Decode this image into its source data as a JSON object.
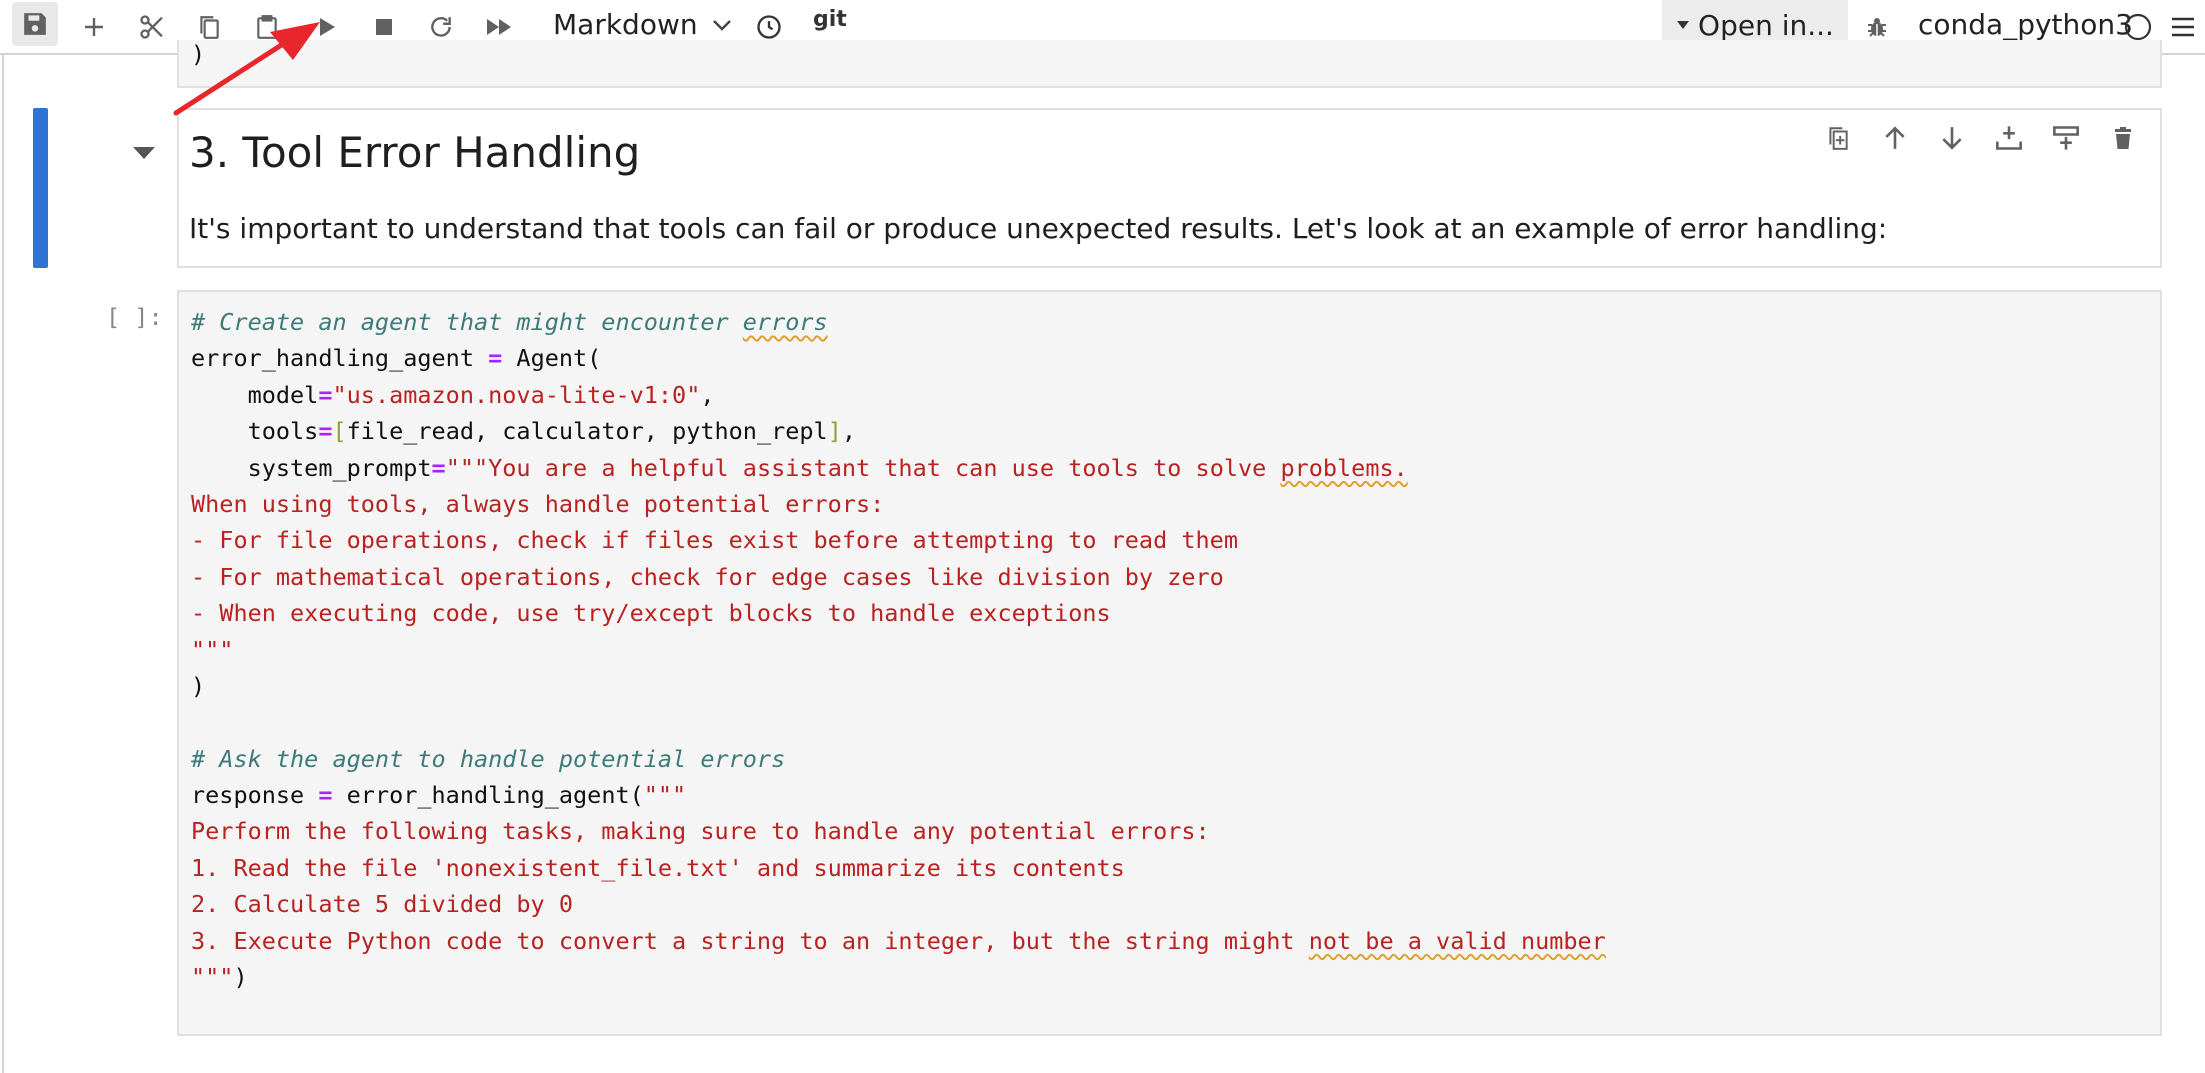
{
  "toolbar": {
    "buttons": [
      {
        "name": "save",
        "icon": "floppy-disk-icon"
      },
      {
        "name": "insert-cell",
        "icon": "plus-icon"
      },
      {
        "name": "cut",
        "icon": "scissors-icon"
      },
      {
        "name": "copy",
        "icon": "copy-icon"
      },
      {
        "name": "paste",
        "icon": "clipboard-icon"
      },
      {
        "name": "run",
        "icon": "play-icon"
      },
      {
        "name": "interrupt",
        "icon": "stop-icon"
      },
      {
        "name": "restart",
        "icon": "refresh-icon"
      },
      {
        "name": "run-all",
        "icon": "fast-forward-icon"
      },
      {
        "name": "history",
        "icon": "clock-icon"
      }
    ],
    "cell_type": "Markdown",
    "git_label": "git",
    "open_in_label": "Open in...",
    "kernel_name": "conda_python3",
    "kernel_status": "idle"
  },
  "previous_cell": {
    "last_line": ")"
  },
  "markdown_cell": {
    "heading": "3. Tool Error Handling",
    "paragraph": "It's important to understand that tools can fail or produce unexpected results. Let's look at an example of error handling:",
    "actions": [
      "duplicate-cell-icon",
      "move-up-icon",
      "move-down-icon",
      "insert-above-icon",
      "insert-below-icon",
      "delete-icon"
    ]
  },
  "code_cell": {
    "prompt": "[ ]:",
    "lines": [
      "# Create an agent that might encounter errors",
      "error_handling_agent = Agent(",
      "    model=\"us.amazon.nova-lite-v1:0\",",
      "    tools=[file_read, calculator, python_repl],",
      "    system_prompt=\"\"\"You are a helpful assistant that can use tools to solve problems.",
      "When using tools, always handle potential errors:",
      "- For file operations, check if files exist before attempting to read them",
      "- For mathematical operations, check for edge cases like division by zero",
      "- When executing code, use try/except blocks to handle exceptions",
      "\"\"\"",
      ")",
      "",
      "# Ask the agent to handle potential errors",
      "response = error_handling_agent(\"\"\"",
      "Perform the following tasks, making sure to handle any potential errors:",
      "1. Read the file 'nonexistent_file.txt' and summarize its contents",
      "2. Calculate 5 divided by 0",
      "3. Execute Python code to convert a string to an integer, but the string might not be a valid number",
      "\"\"\")"
    ]
  },
  "annotation": {
    "arrow_color": "#e8262b"
  },
  "colors": {
    "active_cell_bar": "#2f74d0",
    "comment": "#3d7a7a",
    "string": "#ba2121",
    "operator": "#aa22ff"
  }
}
